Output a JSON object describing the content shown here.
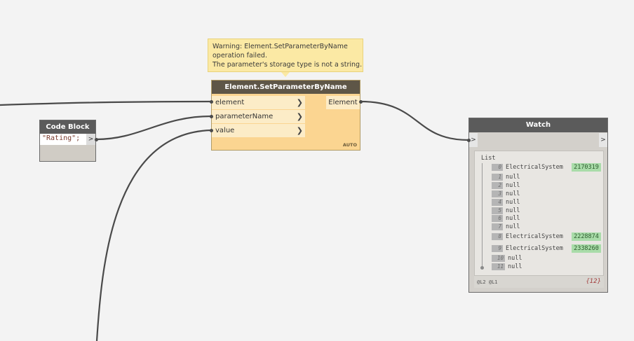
{
  "warning": {
    "lines": [
      "Warning: Element.SetParameterByName",
      "operation failed.",
      "The parameter's storage type is not a string."
    ]
  },
  "code_block": {
    "title": "Code Block",
    "code": "\"Rating\";",
    "output_arrow": ">"
  },
  "set_parameter_node": {
    "title": "Element.SetParameterByName",
    "inputs": [
      "element",
      "parameterName",
      "value"
    ],
    "input_chevron": "❯",
    "output": "Element",
    "lacing": "AUTO"
  },
  "watch_node": {
    "title": "Watch",
    "in_port": ">",
    "out_port": ">",
    "list_label": "List",
    "items": [
      {
        "index": "0",
        "value": "ElectricalSystem",
        "id": "2170319"
      },
      {
        "index": "1",
        "value": "null",
        "id": ""
      },
      {
        "index": "2",
        "value": "null",
        "id": ""
      },
      {
        "index": "3",
        "value": "null",
        "id": ""
      },
      {
        "index": "4",
        "value": "null",
        "id": ""
      },
      {
        "index": "5",
        "value": "null",
        "id": ""
      },
      {
        "index": "6",
        "value": "null",
        "id": ""
      },
      {
        "index": "7",
        "value": "null",
        "id": ""
      },
      {
        "index": "8",
        "value": "ElectricalSystem",
        "id": "2228874"
      },
      {
        "index": "9",
        "value": "ElectricalSystem",
        "id": "2338260"
      },
      {
        "index": "10",
        "value": "null",
        "id": ""
      },
      {
        "index": "11",
        "value": "null",
        "id": ""
      }
    ],
    "levels": "@L2 @L1",
    "count": "{12}"
  },
  "colors": {
    "canvas": "#f3f3f3",
    "wire": "#4a4a4a",
    "warning_bg": "#fbe9a4",
    "node_body": "#fbd591",
    "id_highlight": "#a9dca9"
  }
}
